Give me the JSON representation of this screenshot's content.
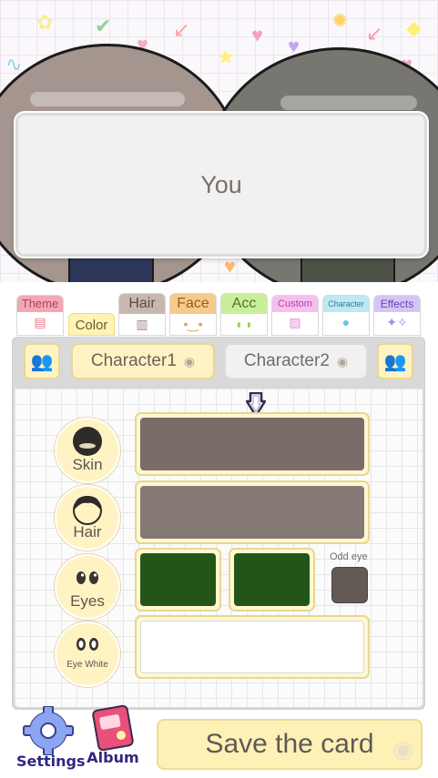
{
  "dialog": {
    "text": "You"
  },
  "tabs": [
    {
      "label": "Theme",
      "icon": "clapperboard-icon"
    },
    {
      "label": "Color",
      "icon": ""
    },
    {
      "label": "Hair",
      "icon": "comb-icon"
    },
    {
      "label": "Face",
      "icon": "face-icon"
    },
    {
      "label": "Acc",
      "icon": "glasses-icon"
    },
    {
      "label": "Custom",
      "icon": "image-icon"
    },
    {
      "label": "Character",
      "icon": "person-icon"
    },
    {
      "label": "Effects",
      "icon": "sparkle-icon"
    }
  ],
  "characters": {
    "char1": "Character1",
    "char2": "Character2"
  },
  "rows": [
    {
      "label": "Skin",
      "color": "#7a6c68"
    },
    {
      "label": "Hair",
      "color": "#857975"
    },
    {
      "label": "Eyes",
      "left_color": "#235616",
      "right_color": "#235616"
    },
    {
      "label": "Eye White",
      "color": "#ffffff"
    }
  ],
  "odd_eye": {
    "label": "Odd eye",
    "color": "#635a55"
  },
  "bottom": {
    "settings": "Settings",
    "album": "Album",
    "save": "Save the card"
  }
}
